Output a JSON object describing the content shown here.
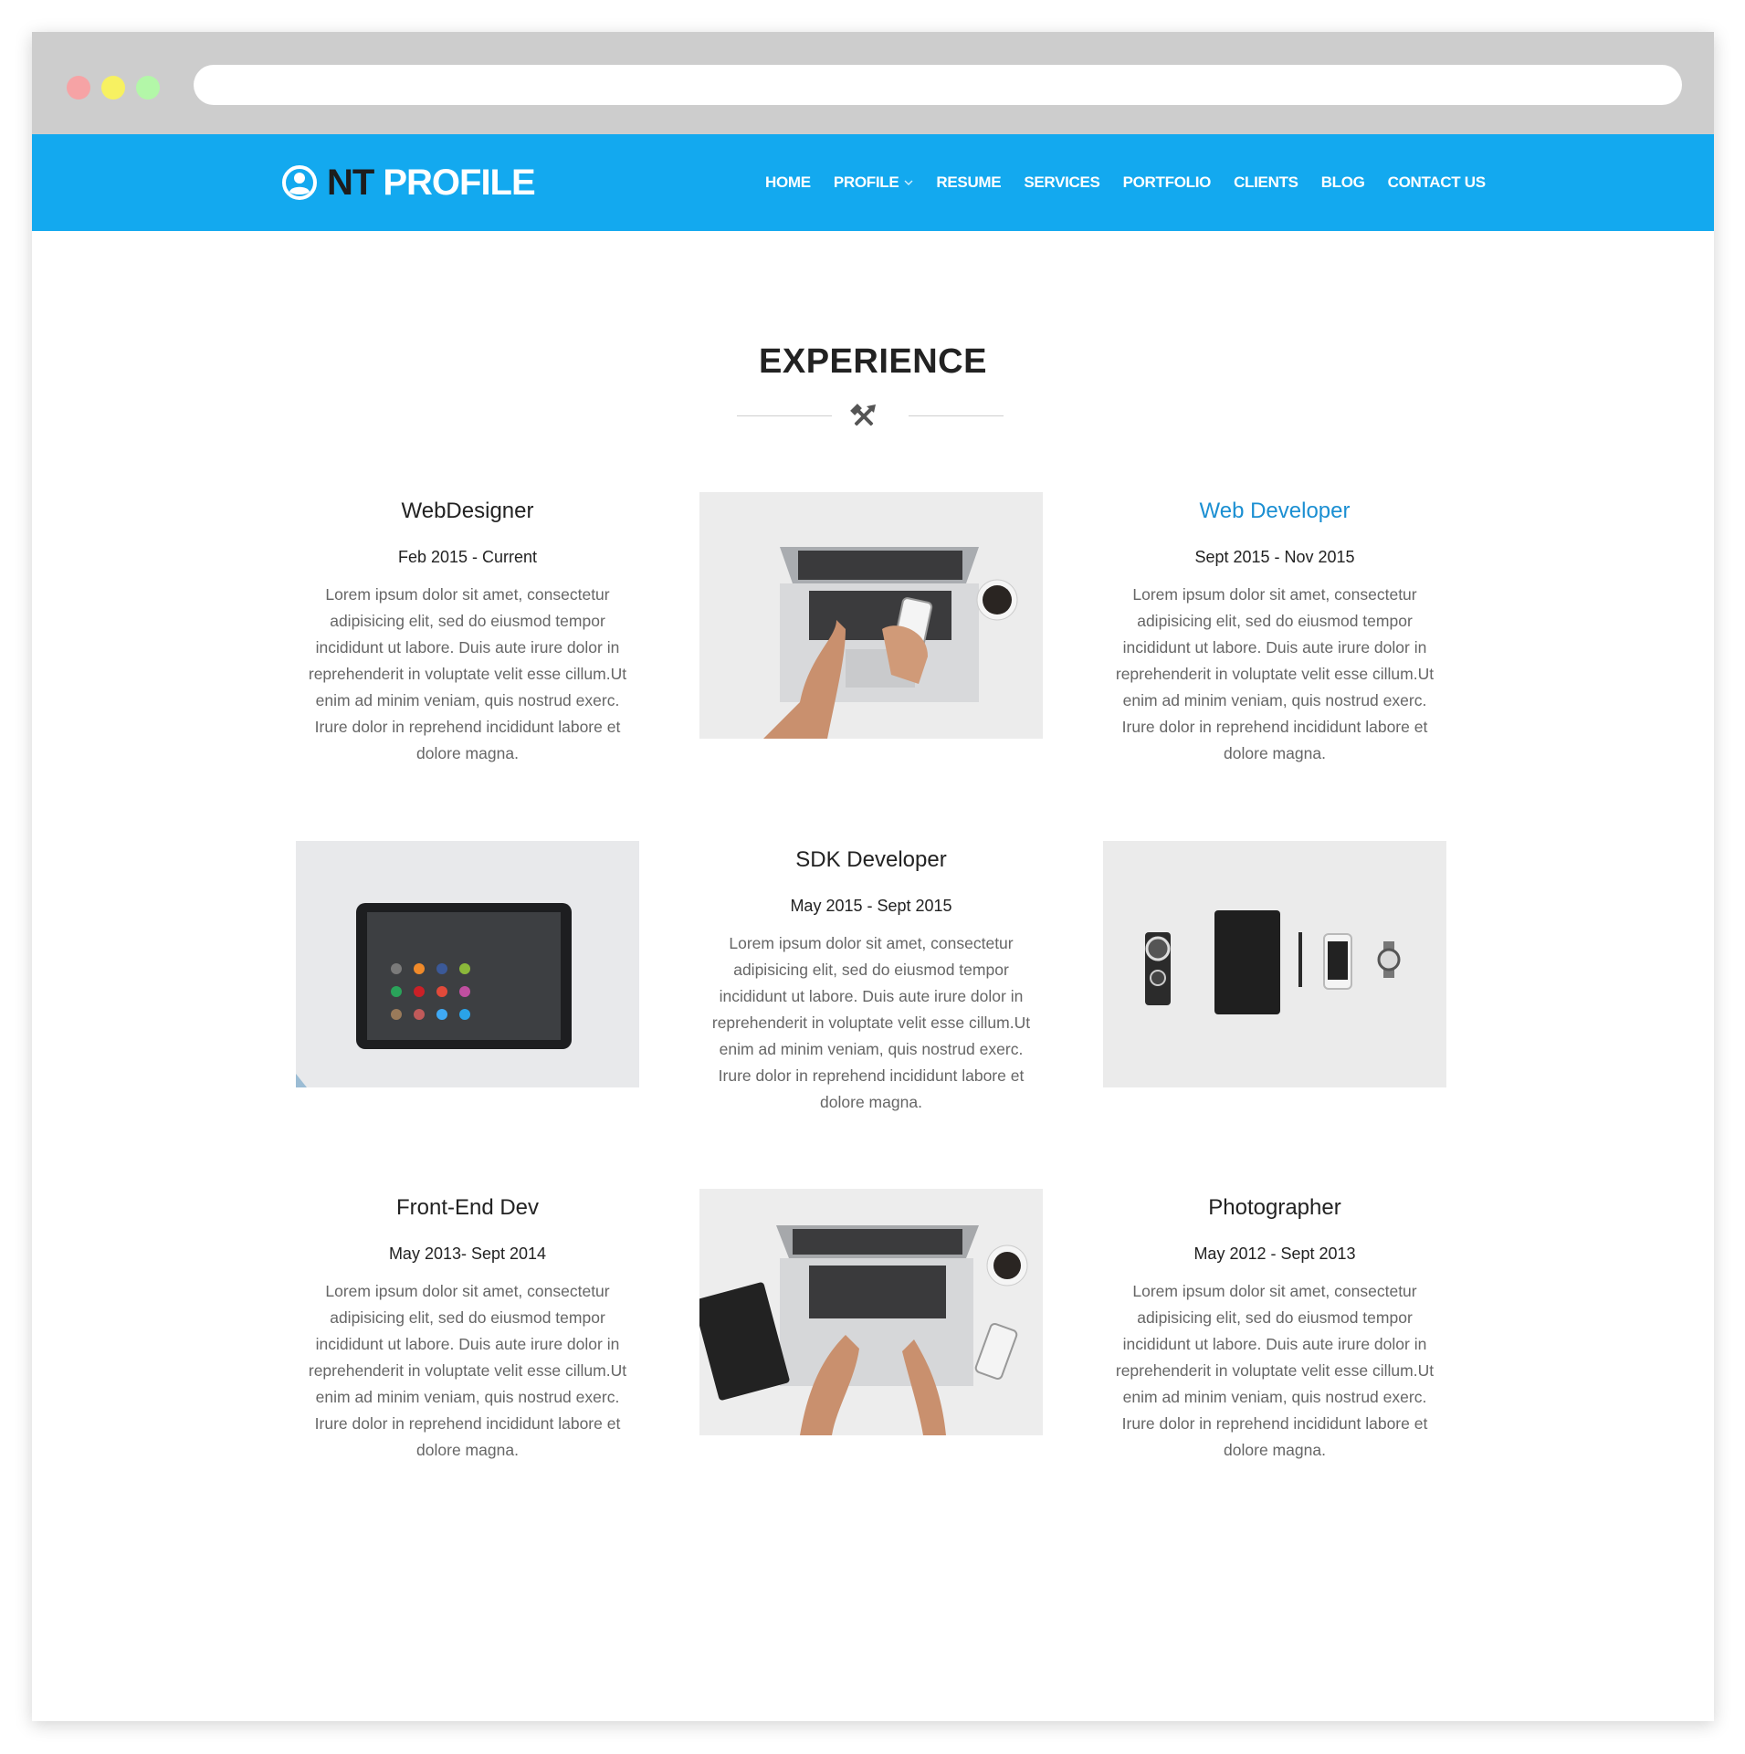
{
  "browser": {
    "url": ""
  },
  "navbar": {
    "logo_prefix": "NT",
    "logo_suffix": "PROFILE",
    "menu": [
      {
        "label": "HOME"
      },
      {
        "label": "PROFILE"
      },
      {
        "label": "RESUME"
      },
      {
        "label": "SERVICES"
      },
      {
        "label": "PORTFOLIO"
      },
      {
        "label": "CLIENTS"
      },
      {
        "label": "BLOG"
      },
      {
        "label": "CONTACT US"
      }
    ]
  },
  "section": {
    "title": "EXPERIENCE",
    "icon": "hammer-pick-icon"
  },
  "experience": [
    {
      "role": "WebDesigner",
      "dates": "Feb 2015 - Current",
      "description": "Lorem ipsum dolor sit amet, consectetur adipisicing elit, sed do eiusmod tempor incididunt ut labore. Duis aute irure dolor in reprehenderit in voluptate velit esse cillum.Ut enim ad minim veniam, quis nostrud exerc. Irure dolor in reprehend incididunt labore et dolore magna."
    },
    {
      "role": "Web Developer",
      "dates": "Sept 2015 - Nov 2015",
      "description": "Lorem ipsum dolor sit amet, consectetur adipisicing elit, sed do eiusmod tempor incididunt ut labore. Duis aute irure dolor in reprehenderit in voluptate velit esse cillum.Ut enim ad minim veniam, quis nostrud exerc. Irure dolor in reprehend incididunt labore et dolore magna."
    },
    {
      "role": "SDK Developer",
      "dates": "May 2015 - Sept 2015",
      "description": "Lorem ipsum dolor sit amet, consectetur adipisicing elit, sed do eiusmod tempor incididunt ut labore. Duis aute irure dolor in reprehenderit in voluptate velit esse cillum.Ut enim ad minim veniam, quis nostrud exerc. Irure dolor in reprehend incididunt labore et dolore magna."
    },
    {
      "role": "Front-End Dev",
      "dates": "May 2013- Sept 2014",
      "description": "Lorem ipsum dolor sit amet, consectetur adipisicing elit, sed do eiusmod tempor incididunt ut labore. Duis aute irure dolor in reprehenderit in voluptate velit esse cillum.Ut enim ad minim veniam, quis nostrud exerc. Irure dolor in reprehend incididunt labore et dolore magna."
    },
    {
      "role": "Photographer",
      "dates": "May 2012 - Sept 2013",
      "description": "Lorem ipsum dolor sit amet, consectetur adipisicing elit, sed do eiusmod tempor incididunt ut labore. Duis aute irure dolor in reprehenderit in voluptate velit esse cillum.Ut enim ad minim veniam, quis nostrud exerc. Irure dolor in reprehend incididunt labore et dolore magna."
    }
  ],
  "colors": {
    "brand": "#13a9ef",
    "accent_text": "#1b8fd2",
    "heading": "#222222",
    "body_text": "#666666"
  }
}
